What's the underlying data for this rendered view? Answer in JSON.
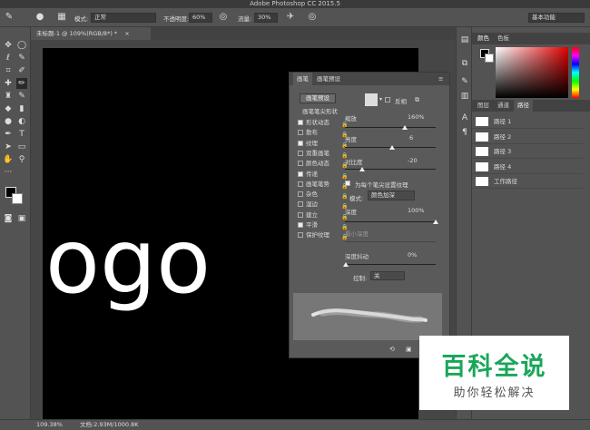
{
  "app_title": "Adobe Photoshop CC 2015.5",
  "options_bar": {
    "mode_label": "模式:",
    "mode_value": "正常",
    "opacity_label": "不透明度:",
    "opacity_value": "60%",
    "flow_label": "流量:",
    "flow_value": "30%",
    "workspace": "基本功能"
  },
  "document_tab": "未标题-1 @ 109%(RGB/8*) *",
  "canvas_text": "ogo",
  "brush_panel": {
    "tab1": "画笔",
    "tab2": "画笔预设",
    "preset_button": "画笔预设",
    "tip_shape": "画笔笔尖形状",
    "items": [
      {
        "label": "形状动态",
        "checked": true
      },
      {
        "label": "散布",
        "checked": false
      },
      {
        "label": "纹理",
        "checked": true
      },
      {
        "label": "双重画笔",
        "checked": false
      },
      {
        "label": "颜色动态",
        "checked": false
      },
      {
        "label": "传递",
        "checked": true
      },
      {
        "label": "画笔笔势",
        "checked": false
      },
      {
        "label": "杂色",
        "checked": false
      },
      {
        "label": "湿边",
        "checked": false
      },
      {
        "label": "建立",
        "checked": false
      },
      {
        "label": "平滑",
        "checked": true
      },
      {
        "label": "保护纹理",
        "checked": false
      }
    ],
    "invert_label": "反相",
    "scale_label": "缩放",
    "scale_value": "160%",
    "brightness_label": "亮度",
    "brightness_value": "6",
    "contrast_label": "对比度",
    "contrast_value": "-20",
    "per_tip_label": "为每个笔尖设置纹理",
    "mode_label": "模式:",
    "mode_value": "颜色加深",
    "depth_label": "深度",
    "depth_value": "100%",
    "min_depth_label": "最小深度",
    "depth_jitter_label": "深度抖动",
    "depth_jitter_value": "0%",
    "control_label": "控制:",
    "control_value": "关"
  },
  "right_panel": {
    "color_tab": "颜色",
    "swatches_tab": "色板",
    "layers_tab": "图层",
    "channels_tab": "通道",
    "paths_tab": "路径",
    "paths": [
      "路径 1",
      "路径 2",
      "路径 3",
      "路径 4",
      "工作路径"
    ]
  },
  "status": {
    "zoom": "109.38%",
    "doc": "文档:2.93M/1000.8K"
  },
  "watermark": {
    "title": "百科全说",
    "subtitle": "助你轻松解决"
  }
}
